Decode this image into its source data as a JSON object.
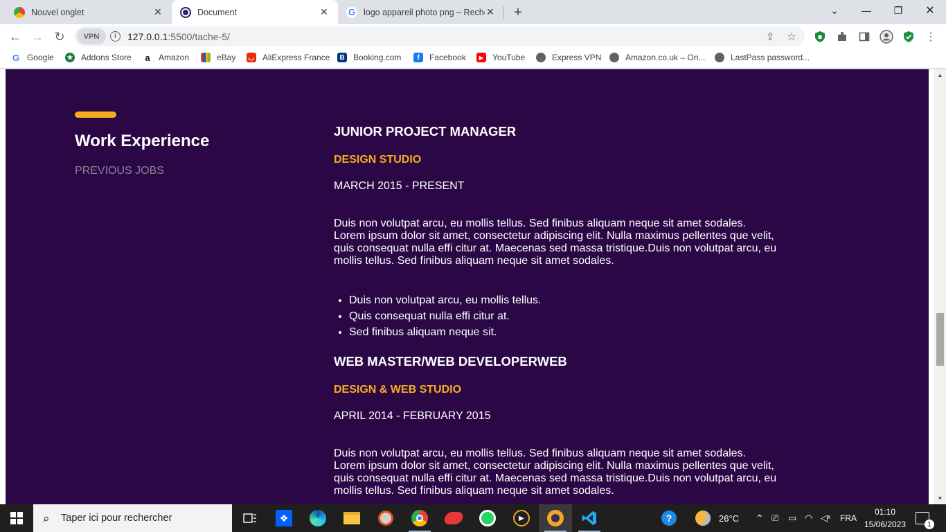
{
  "browser": {
    "tabs": [
      {
        "title": "Nouvel onglet",
        "active": false
      },
      {
        "title": "Document",
        "active": true
      },
      {
        "title": "logo appareil photo png – Reche",
        "active": false
      }
    ],
    "url_host": "127.0.0.1",
    "url_path": ":5500/tache-5/",
    "vpn_label": "VPN"
  },
  "bookmarks": [
    {
      "label": "Google",
      "icon": "google-icon"
    },
    {
      "label": "Addons Store",
      "icon": "addons-store-icon"
    },
    {
      "label": "Amazon",
      "icon": "amazon-icon"
    },
    {
      "label": "eBay",
      "icon": "ebay-icon"
    },
    {
      "label": "AliExpress France",
      "icon": "aliexpress-icon"
    },
    {
      "label": "Booking.com",
      "icon": "booking-icon"
    },
    {
      "label": "Facebook",
      "icon": "facebook-icon"
    },
    {
      "label": "YouTube",
      "icon": "youtube-icon"
    },
    {
      "label": "Express VPN",
      "icon": "globe-icon"
    },
    {
      "label": "Amazon.co.uk – On...",
      "icon": "globe-icon"
    },
    {
      "label": "LastPass password...",
      "icon": "globe-icon"
    }
  ],
  "section": {
    "title": "Work Experience",
    "subtitle": "PREVIOUS JOBS"
  },
  "jobs": [
    {
      "title": "JUNIOR PROJECT MANAGER",
      "company": "DESIGN STUDIO",
      "date": "MARCH 2015 - PRESENT",
      "description": "Duis non volutpat arcu, eu mollis tellus. Sed finibus aliquam neque sit amet sodales. Lorem ipsum dolor sit amet, consectetur adipiscing elit. Nulla maximus pellentes que velit, quis consequat nulla effi citur at. Maecenas sed massa tristique.Duis non volutpat arcu, eu mollis tellus. Sed finibus aliquam neque sit amet sodales.",
      "bullets": [
        "Duis non volutpat arcu, eu mollis tellus.",
        "Quis consequat nulla effi citur at.",
        "Sed finibus aliquam neque sit."
      ]
    },
    {
      "title": "WEB MASTER/WEB DEVELOPERWEB",
      "company": "DESIGN & WEB STUDIO",
      "date": "APRIL 2014 - FEBRUARY 2015",
      "description": "Duis non volutpat arcu, eu mollis tellus. Sed finibus aliquam neque sit amet sodales. Lorem ipsum dolor sit amet, consectetur adipiscing elit. Nulla maximus pellentes que velit, quis consequat nulla effi citur at. Maecenas sed massa tristique.Duis non volutpat arcu, eu mollis tellus. Sed finibus aliquam neque sit amet sodales."
    }
  ],
  "colors": {
    "page_bg": "#2b0845",
    "accent": "#f6ae1c",
    "muted": "#8d8399"
  },
  "taskbar": {
    "search_placeholder": "Taper ici pour rechercher",
    "weather": "26°C",
    "language": "FRA",
    "time": "01:10",
    "date": "15/06/2023",
    "notification_count": "1"
  }
}
